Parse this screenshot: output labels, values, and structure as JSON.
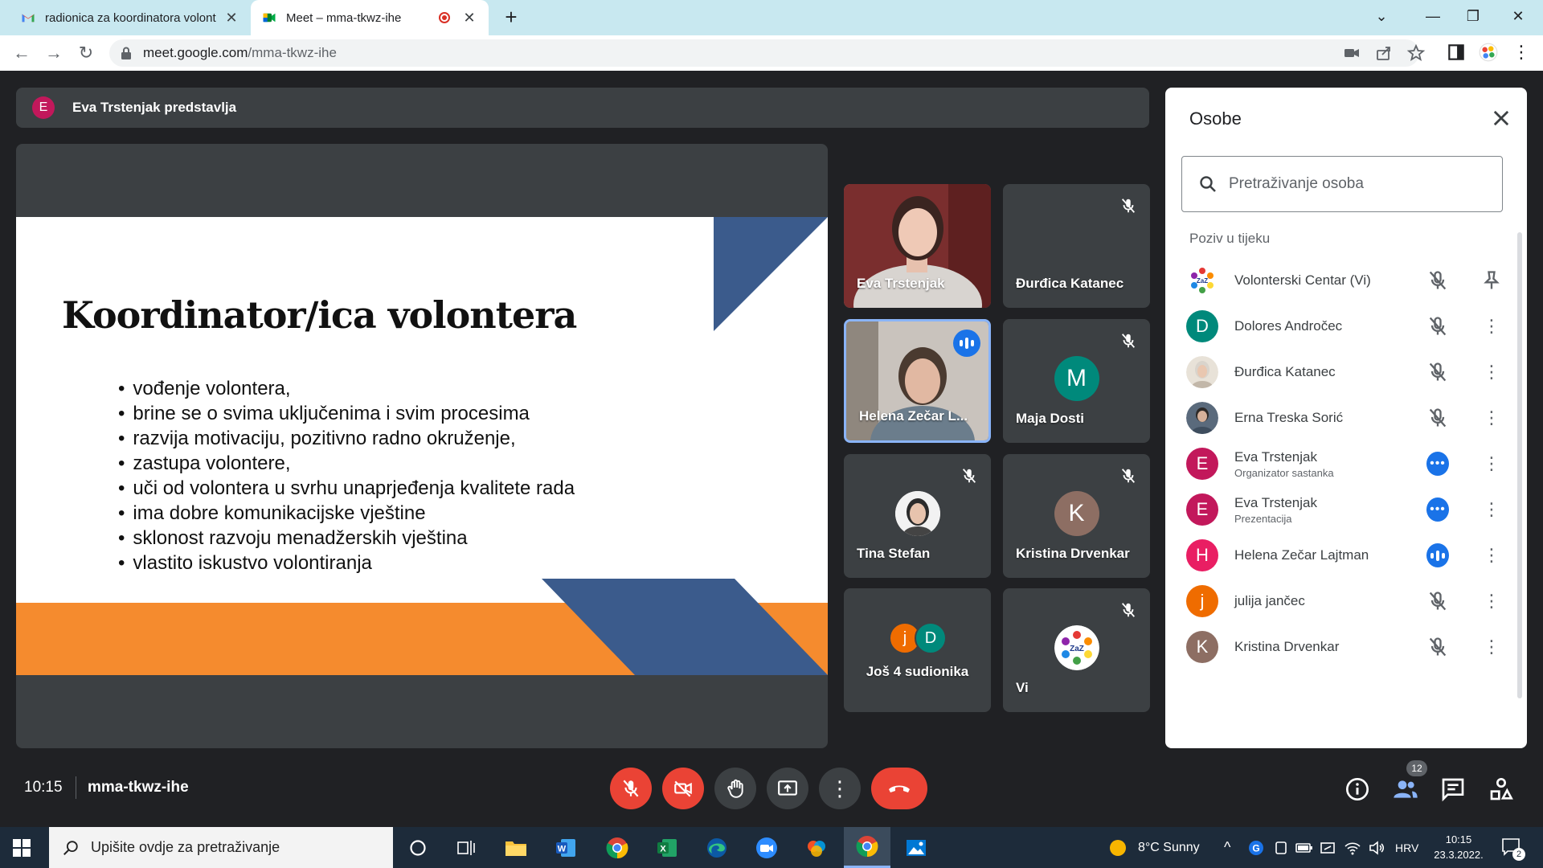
{
  "browser": {
    "tabs": [
      {
        "title": "radionica za koordinatora volont"
      },
      {
        "title": "Meet – mma-tkwz-ihe"
      }
    ],
    "url_host": "meet.google.com",
    "url_path": "/mma-tkwz-ihe"
  },
  "presenting_bar": {
    "avatar_letter": "E",
    "text": "Eva Trstenjak predstavlja"
  },
  "slide": {
    "title": "Koordinator/ica volontera",
    "bullets": [
      "vođenje volontera,",
      "brine se o svima uključenima i svim procesima",
      "razvija motivaciju, pozitivno radno okruženje,",
      "zastupa volontere,",
      "uči od volontera u svrhu unaprjeđenja kvalitete rada",
      "ima dobre komunikacijske vještine",
      "sklonost razvoju menadžerskih vještina",
      "vlastito iskustvo volontiranja"
    ],
    "colors": {
      "blue": "#3b5b8c",
      "orange": "#f58b2e"
    }
  },
  "tiles": [
    {
      "name": "Eva Trstenjak",
      "type": "video"
    },
    {
      "name": "Đurđica Katanec",
      "type": "muted"
    },
    {
      "name": "Helena Zečar L...",
      "type": "video-speaking"
    },
    {
      "name": "Maja Dosti",
      "avatar": "M",
      "color": "#00897b"
    },
    {
      "name": "Tina Stefan",
      "type": "photo"
    },
    {
      "name": "Kristina Drvenkar",
      "avatar": "K",
      "color": "#8d6e63"
    },
    {
      "name": "Još 4 sudionika",
      "avatars": [
        "j",
        "D"
      ]
    },
    {
      "name": "Vi",
      "type": "logo"
    }
  ],
  "people_panel": {
    "title": "Osobe",
    "search_placeholder": "Pretraživanje osoba",
    "section": "Poziv u tijeku",
    "people": [
      {
        "name": "Volonterski Centar (Vi)",
        "sub": "",
        "avatar": "logo",
        "action": "pin"
      },
      {
        "name": "Dolores Andročec",
        "sub": "",
        "avatar": "D",
        "color": "#00897b",
        "action": "muted"
      },
      {
        "name": "Đurđica Katanec",
        "sub": "",
        "avatar": "photo",
        "action": "muted"
      },
      {
        "name": "Erna Treska Sorić",
        "sub": "",
        "avatar": "photo",
        "action": "muted"
      },
      {
        "name": "Eva Trstenjak",
        "sub": "Organizator sastanka",
        "avatar": "E",
        "color": "#c2185b",
        "action": "more"
      },
      {
        "name": "Eva Trstenjak",
        "sub": "Prezentacija",
        "avatar": "E",
        "color": "#c2185b",
        "action": "more"
      },
      {
        "name": "Helena Zečar Lajtman",
        "sub": "",
        "avatar": "H",
        "color": "#e91e63",
        "action": "speaking"
      },
      {
        "name": "julija jančec",
        "sub": "",
        "avatar": "j",
        "color": "#ef6c00",
        "action": "muted"
      },
      {
        "name": "Kristina Drvenkar",
        "sub": "",
        "avatar": "K",
        "color": "#8d6e63",
        "action": "muted"
      }
    ]
  },
  "controls": {
    "time": "10:15",
    "meeting_code": "mma-tkwz-ihe",
    "participant_count": "12"
  },
  "taskbar": {
    "search_placeholder": "Upišite ovdje za pretraživanje",
    "weather": "8°C  Sunny",
    "language": "HRV",
    "time": "10:15",
    "date": "23.3.2022.",
    "notifications": "2"
  }
}
